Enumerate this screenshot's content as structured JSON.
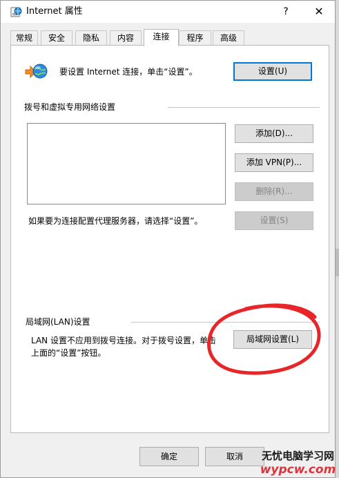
{
  "window": {
    "title": "Internet 属性",
    "help_glyph": "?",
    "close_glyph": "✕"
  },
  "tabs": [
    {
      "label": "常规",
      "active": false
    },
    {
      "label": "安全",
      "active": false
    },
    {
      "label": "隐私",
      "active": false
    },
    {
      "label": "内容",
      "active": false
    },
    {
      "label": "连接",
      "active": true
    },
    {
      "label": "程序",
      "active": false
    },
    {
      "label": "高级",
      "active": false
    }
  ],
  "setup": {
    "text": "要设置 Internet 连接，单击“设置”。",
    "button": "设置(U)"
  },
  "dialup": {
    "heading": "拨号和虚拟专用网络设置",
    "add": "添加(D)...",
    "add_vpn": "添加 VPN(P)...",
    "remove": "删除(R)...",
    "settings": "设置(S)",
    "proxy_text": "如果要为连接配置代理服务器，请选择“设置”。"
  },
  "lan": {
    "heading": "局域网(LAN)设置",
    "text_line1": "LAN 设置不应用到拨号连接。对于拨号设置，单击",
    "text_line2": "上面的“设置”按钮。",
    "button": "局域网设置(L)"
  },
  "footer": {
    "ok": "确定",
    "cancel": "取消"
  },
  "watermark": {
    "line1": "无忧电脑学习网",
    "line2": "wypcw.com"
  },
  "colors": {
    "annotation_circle": "#e8262a",
    "primary_border": "#0078d7"
  }
}
